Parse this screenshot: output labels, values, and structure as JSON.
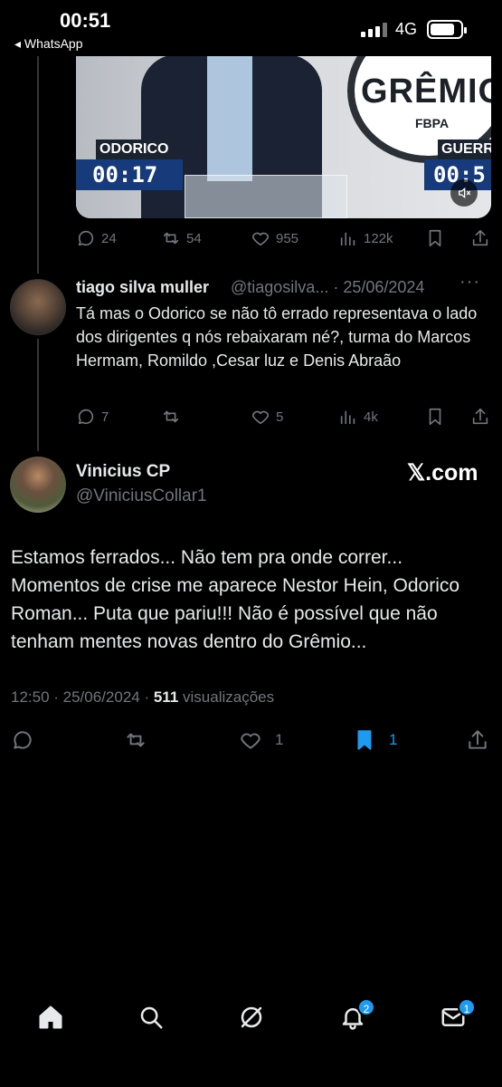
{
  "status_bar": {
    "time": "00:51",
    "back_app": "◂ WhatsApp",
    "network": "4G"
  },
  "media": {
    "left_name": "ODORICO",
    "left_timer": "00:17",
    "right_name": "GUERR",
    "right_timer": "00:5",
    "logo_text": "GRÊMIO",
    "logo_sub": "FBPA"
  },
  "tweet_top_actions": {
    "replies": "24",
    "retweets": "54",
    "likes": "955",
    "views": "122k"
  },
  "reply": {
    "name": "tiago silva muller",
    "handle": "@tiagosilva... · 25/06/2024",
    "more": "···",
    "text": "Tá mas o Odorico se não tô errado representava o lado dos dirigentes q nós rebaixaram né?, turma do Marcos Hermam, Romildo ,Cesar luz e Denis Abraão",
    "actions": {
      "replies": "7",
      "retweets": "",
      "likes": "5",
      "views": "4k"
    }
  },
  "main_tweet": {
    "name": "Vinicius CP",
    "handle": "@ViniciusCollar1",
    "brand": "𝕏.com",
    "text": "Estamos ferrados... Não tem pra onde correr... Momentos de crise me aparece Nestor Hein, Odorico Roman... Puta que pariu!!! Não é possível que não tenham mentes novas dentro do Grêmio...",
    "time_date": "12:50 · 25/06/2024 · ",
    "views_count": "511",
    "views_label": " visualizações",
    "actions": {
      "likes": "1",
      "bookmarks": "1"
    }
  },
  "bottom_nav": {
    "notifications_badge": "2",
    "messages_badge": "1"
  },
  "colors": {
    "accent": "#1d9bf0",
    "muted": "#71767b",
    "text": "#e7e9ea",
    "bg": "#000000"
  }
}
